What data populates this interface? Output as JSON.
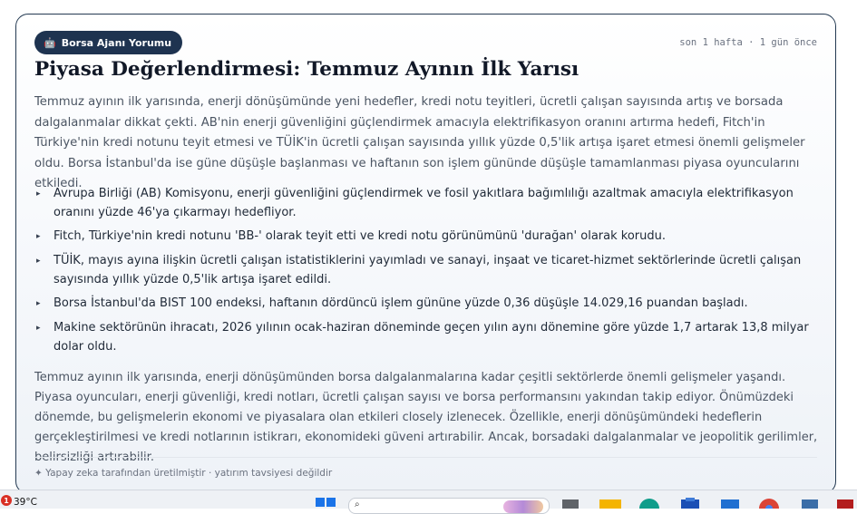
{
  "card": {
    "badge": {
      "icon": "robot-icon",
      "label": "Borsa Ajanı Yorumu"
    },
    "timestamp": "son 1 hafta · 1 gün önce",
    "title": "Piyasa Değerlendirmesi: Temmuz Ayının İlk Yarısı",
    "intro": "Temmuz ayının ilk yarısında, enerji dönüşümünde yeni hedefler, kredi notu teyitleri, ücretli çalışan sayısında artış ve borsada dalgalanmalar dikkat çekti. AB'nin enerji güvenliğini güçlendirmek amacıyla elektrifikasyon oranını artırma hedefi, Fitch'in Türkiye'nin kredi notunu teyit etmesi ve TÜİK'in ücretli çalışan sayısında yıllık yüzde 0,5'lik artışa işaret etmesi önemli gelişmeler oldu. Borsa İstanbul'da ise güne düşüşle başlanması ve haftanın son işlem gününde düşüşle tamamlanması piyasa oyuncularını etkiledi.",
    "bullets": [
      "Avrupa Birliği (AB) Komisyonu, enerji güvenliğini güçlendirmek ve fosil yakıtlara bağımlılığı azaltmak amacıyla elektrifikasyon oranını yüzde 46'ya çıkarmayı hedefliyor.",
      "Fitch, Türkiye'nin kredi notunu 'BB-' olarak teyit etti ve kredi notu görünümünü 'durağan' olarak korudu.",
      "TÜİK, mayıs ayına ilişkin ücretli çalışan istatistiklerini yayımladı ve sanayi, inşaat ve ticaret-hizmet sektörlerinde ücretli çalışan sayısında yıllık yüzde 0,5'lik artışa işaret edildi.",
      "Borsa İstanbul'da BIST 100 endeksi, haftanın dördüncü işlem gününe yüzde 0,36 düşüşle 14.029,16 puandan başladı.",
      "Makine sektörünün ihracatı, 2026 yılının ocak-haziran döneminde geçen yılın aynı dönemine göre yüzde 1,7 artarak 13,8 milyar dolar oldu."
    ],
    "bullet_marker": "▸",
    "summary": "Temmuz ayının ilk yarısında, enerji dönüşümünden borsa dalgalanmalarına kadar çeşitli sektörlerde önemli gelişmeler yaşandı. Piyasa oyuncuları, enerji güvenliği, kredi notları, ücretli çalışan sayısı ve borsa performansını yakından takip ediyor. Önümüzdeki dönemde, bu gelişmelerin ekonomi ve piyasalara olan etkileri closely izlenecek. Özellikle, enerji dönüşümündeki hedeflerin gerçekleştirilmesi ve kredi notlarının istikrarı, ekonomideki güveni artırabilir. Ancak, borsadaki dalgalanmalar ve jeopolitik gerilimler, belirsizliği artırabilir.",
    "footer": "✦ Yapay zeka tarafından üretilmiştir · yatırım tavsiyesi değildir"
  },
  "taskbar": {
    "notification_count": "1",
    "temperature": "39°C"
  }
}
